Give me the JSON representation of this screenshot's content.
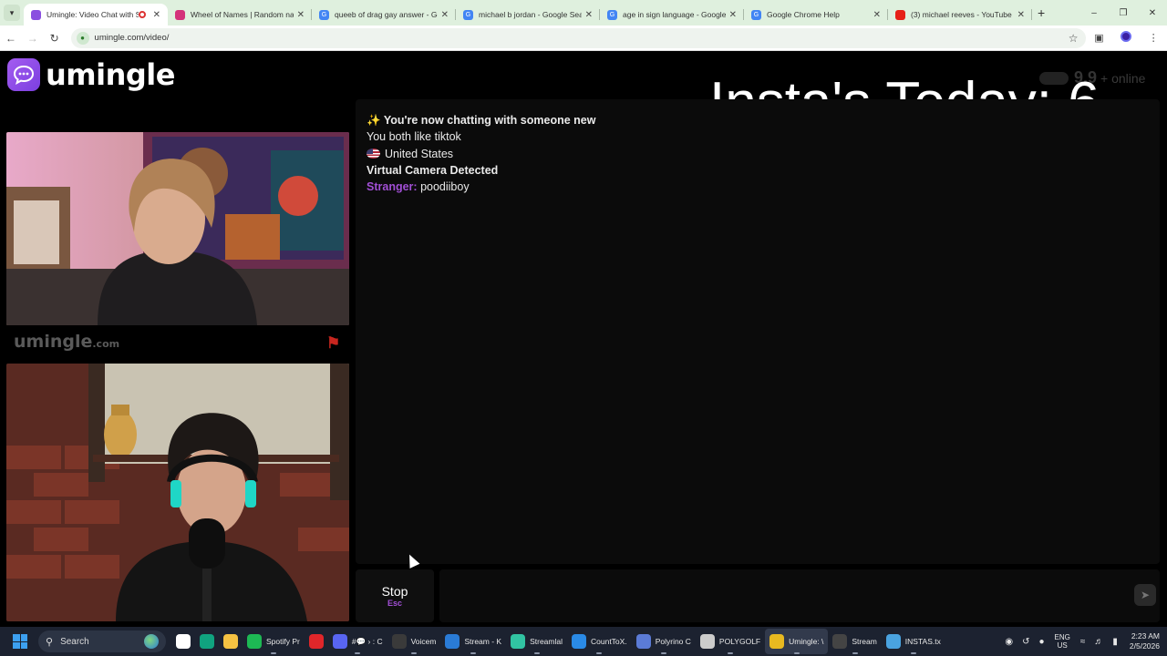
{
  "browser": {
    "tabs": [
      {
        "title": "Umingle: Video Chat with S",
        "active": true,
        "icon": "umingle-icon",
        "recording": true
      },
      {
        "title": "Wheel of Names | Random nam",
        "active": false,
        "icon": "wheel-icon"
      },
      {
        "title": "queeb of drag gay answer - Go",
        "active": false,
        "icon": "google-icon"
      },
      {
        "title": "michael b jordan - Google Sea",
        "active": false,
        "icon": "google-icon"
      },
      {
        "title": "age in sign language - Google",
        "active": false,
        "icon": "google-icon"
      },
      {
        "title": "Google Chrome Help",
        "active": false,
        "icon": "google-icon"
      },
      {
        "title": "(3) michael reeves - YouTube",
        "active": false,
        "icon": "youtube-icon"
      }
    ],
    "url": "umingle.com/video/"
  },
  "page": {
    "logo_text": "umingle",
    "overlay_title": "Insta's Today:  6",
    "online_count": "9,9",
    "online_label": "+ online",
    "watermark_main": "umingle",
    "watermark_suffix": ".com",
    "chat": {
      "line1": "You're now chatting with someone new",
      "line2": "You both like tiktok",
      "line3": "United States",
      "line4": "Virtual Camera Detected",
      "stranger_label": "Stranger:",
      "stranger_message": "poodiiboy"
    },
    "stop_label": "Stop",
    "stop_key": "Esc"
  },
  "taskbar": {
    "search_label": "Search",
    "items": [
      {
        "label": "",
        "icon": "widgets-icon",
        "color": "#ffffff"
      },
      {
        "label": "",
        "icon": "chatgpt-icon",
        "color": "#10a37f"
      },
      {
        "label": "",
        "icon": "file-explorer-icon",
        "color": "#f5c242"
      },
      {
        "label": "Spotify Pr",
        "icon": "spotify-icon",
        "color": "#1db954"
      },
      {
        "label": "",
        "icon": "opera-icon",
        "color": "#e0262a"
      },
      {
        "label": "#💬 › : C",
        "icon": "discord-icon",
        "color": "#5865f2"
      },
      {
        "label": "Voicem",
        "icon": "voicemeeter-icon",
        "color": "#3a3a3a"
      },
      {
        "label": "Stream - K",
        "icon": "edge-icon",
        "color": "#2a7bd6"
      },
      {
        "label": "Streamlal",
        "icon": "streamlabs-icon",
        "color": "#31c3a2"
      },
      {
        "label": "CountToX.",
        "icon": "vscode-icon",
        "color": "#2a8ae6"
      },
      {
        "label": "Polyrino C",
        "icon": "pen-icon",
        "color": "#5b7bd6"
      },
      {
        "label": "POLYGOLF",
        "icon": "window-icon",
        "color": "#cccccc"
      },
      {
        "label": "Umingle: \\",
        "icon": "chrome-icon",
        "color": "#e8b920"
      },
      {
        "label": "Stream",
        "icon": "obs-icon",
        "color": "#444444"
      },
      {
        "label": "INSTAS.tx",
        "icon": "notepad-icon",
        "color": "#4aa3e0"
      }
    ],
    "lang_top": "ENG",
    "lang_bottom": "US",
    "time": "2:23 AM",
    "date": "2/5/2026"
  }
}
